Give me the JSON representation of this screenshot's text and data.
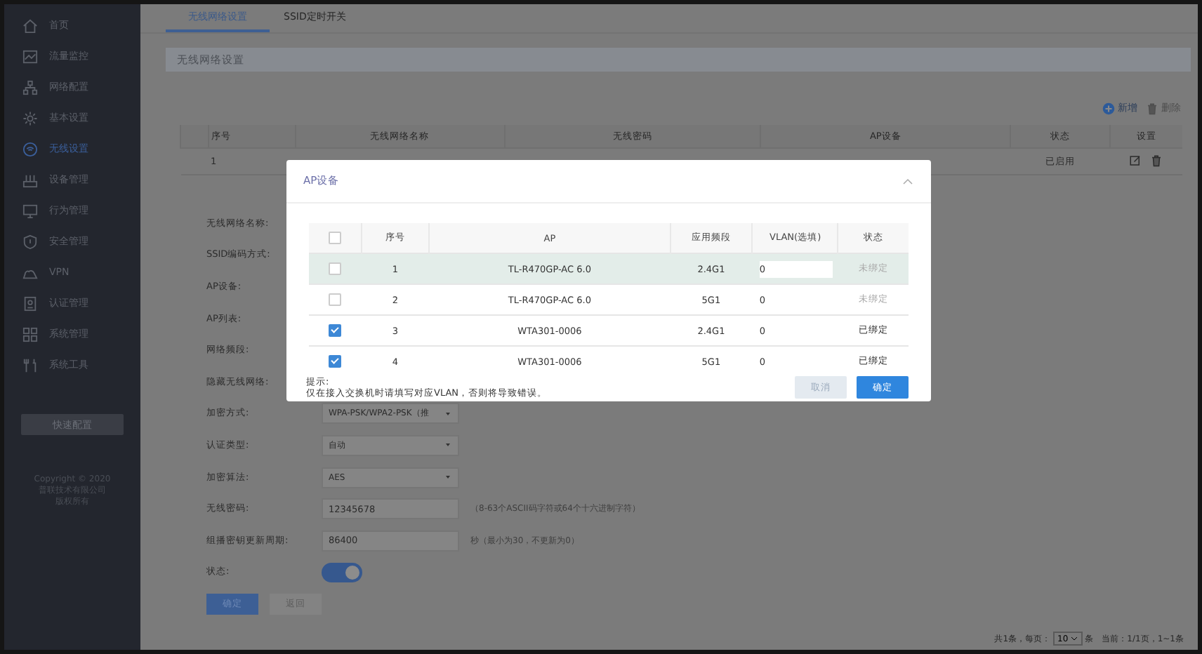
{
  "sidebar": {
    "items": [
      {
        "label": "首页",
        "selected": false
      },
      {
        "label": "流量监控",
        "selected": false
      },
      {
        "label": "网络配置",
        "selected": false
      },
      {
        "label": "基本设置",
        "selected": false
      },
      {
        "label": "无线设置",
        "selected": true
      },
      {
        "label": "设备管理",
        "selected": false
      },
      {
        "label": "行为管理",
        "selected": false
      },
      {
        "label": "安全管理",
        "selected": false
      },
      {
        "label": "VPN",
        "selected": false
      },
      {
        "label": "认证管理",
        "selected": false
      },
      {
        "label": "系统管理",
        "selected": false
      },
      {
        "label": "系统工具",
        "selected": false
      }
    ],
    "quick_button": "快速配置",
    "copyright": [
      "Copyright © 2020",
      "普联技术有限公司",
      "版权所有"
    ]
  },
  "tabs": [
    {
      "label": "无线网络设置",
      "selected": true
    },
    {
      "label": "SSID定时开关",
      "selected": false
    }
  ],
  "section_title": "无线网络设置",
  "toolbar": {
    "add": "新增",
    "delete": "删除"
  },
  "table": {
    "columns": [
      "序号",
      "无线网络名称",
      "无线密码",
      "AP设备",
      "状态",
      "设置"
    ],
    "rows": [
      {
        "index": "1",
        "status": "已启用"
      }
    ]
  },
  "form": {
    "fields": [
      {
        "label": "无线网络名称:"
      },
      {
        "label": "SSID编码方式:"
      },
      {
        "label": "AP设备:"
      },
      {
        "label": "AP列表:"
      },
      {
        "label": "网络频段:"
      },
      {
        "label": "隐藏无线网络:"
      },
      {
        "label": "加密方式:",
        "kind": "select",
        "value": "WPA-PSK/WPA2-PSK（推"
      },
      {
        "label": "认证类型:",
        "kind": "select",
        "value": "自动"
      },
      {
        "label": "加密算法:",
        "kind": "select",
        "value": "AES"
      },
      {
        "label": "无线密码:",
        "kind": "input",
        "value": "12345678",
        "hint": "（8-63个ASCII码字符或64个十六进制字符）"
      },
      {
        "label": "组播密钥更新周期:",
        "kind": "input",
        "value": "86400",
        "hint": "秒（最小为30，不更新为0）"
      },
      {
        "label": "状态:",
        "kind": "toggle",
        "on": true
      }
    ],
    "buttons": [
      "确定",
      "返回"
    ]
  },
  "pagination": {
    "total": "共1条，每页：",
    "page_size": "10",
    "unit": "条",
    "current": "当前：1/1页，1~1条"
  },
  "dialog": {
    "title": "AP设备",
    "header_checked": false,
    "columns": [
      "序号",
      "AP",
      "应用频段",
      "VLAN(选填)",
      "状态"
    ],
    "rows": [
      {
        "checked": false,
        "selected": true,
        "index": "1",
        "ap": "TL-R470GP-AC 6.0",
        "band": "2.4G1",
        "vlan": "0",
        "status": "未绑定"
      },
      {
        "checked": false,
        "selected": false,
        "index": "2",
        "ap": "TL-R470GP-AC 6.0",
        "band": "5G1",
        "vlan": "0",
        "status": "未绑定"
      },
      {
        "checked": true,
        "selected": false,
        "index": "3",
        "ap": "WTA301-0006",
        "band": "2.4G1",
        "vlan": "0",
        "status": "已绑定"
      },
      {
        "checked": true,
        "selected": false,
        "index": "4",
        "ap": "WTA301-0006",
        "band": "5G1",
        "vlan": "0",
        "status": "已绑定"
      }
    ],
    "hint_title": "提示:",
    "hint": "仅在接入交换机时请填写对应VLAN，否则将导致错误。",
    "cancel": {
      "label": "取消",
      "disabled": true
    },
    "ok": "确定"
  }
}
